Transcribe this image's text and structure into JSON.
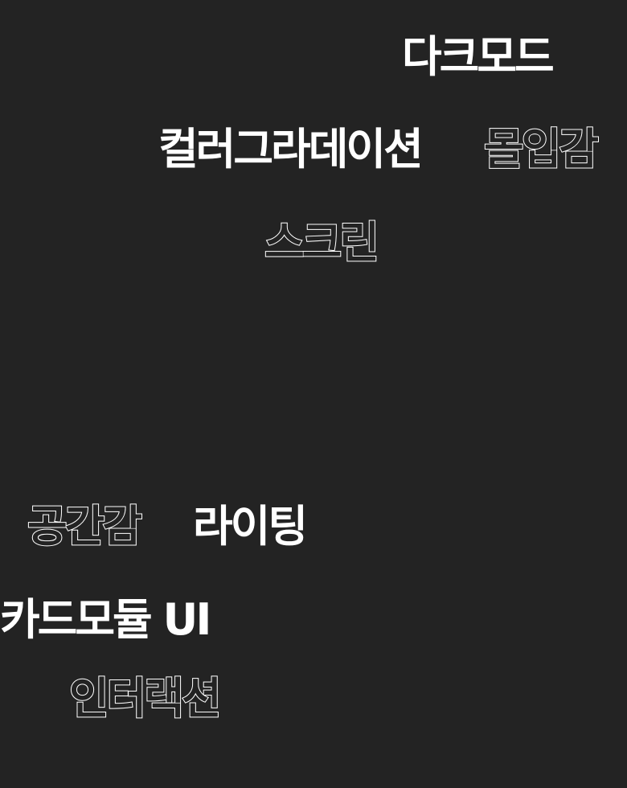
{
  "words": {
    "dark_mode": "다크모드",
    "color_gradation": "컬러그라데이션",
    "immersion": "몰입감",
    "screen": "스크린",
    "sense_of_space": "공간감",
    "lighting": "라이팅",
    "card_module_ui": "카드모듈 UI",
    "interaction": "인터랙션"
  },
  "colors": {
    "background": "#232323",
    "text": "#ffffff"
  }
}
